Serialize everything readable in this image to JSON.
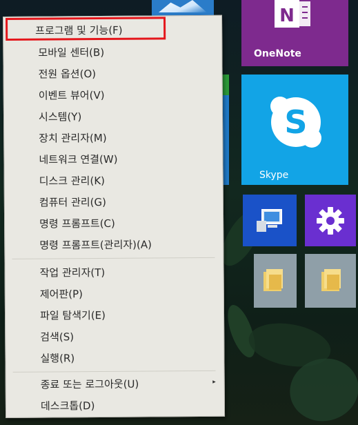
{
  "menu": {
    "items": [
      {
        "label": "프로그램 및 기능(F)"
      },
      {
        "label": "모바일 센터(B)"
      },
      {
        "label": "전원 옵션(O)"
      },
      {
        "label": "이벤트 뷰어(V)"
      },
      {
        "label": "시스템(Y)"
      },
      {
        "label": "장치 관리자(M)"
      },
      {
        "label": "네트워크 연결(W)"
      },
      {
        "label": "디스크 관리(K)"
      },
      {
        "label": "컴퓨터 관리(G)"
      },
      {
        "label": "명령 프롬프트(C)"
      },
      {
        "label": "명령 프롬프트(관리자)(A)"
      },
      {
        "label": "작업 관리자(T)"
      },
      {
        "label": "제어판(P)"
      },
      {
        "label": "파일 탐색기(E)"
      },
      {
        "label": "검색(S)"
      },
      {
        "label": "실행(R)"
      },
      {
        "label": "종료 또는 로그아웃(U)"
      },
      {
        "label": "데스크톱(D)"
      }
    ],
    "highlight_color": "#e4161b",
    "submenu_arrow": "▸"
  },
  "tiles": {
    "onenote": {
      "label": "OneNote",
      "color": "#7e2a8e"
    },
    "skype": {
      "label": "Skype",
      "color": "#12a4e6"
    },
    "this_pc": {
      "icon": "computer-icon",
      "color": "#1a52c8"
    },
    "settings": {
      "icon": "gear-icon",
      "color": "#6a2fd0"
    },
    "file_explorer_1": {
      "icon": "folder-icon",
      "color": "#8f9fa8"
    },
    "file_explorer_2": {
      "icon": "folder-icon",
      "color": "#8f9fa8"
    }
  }
}
